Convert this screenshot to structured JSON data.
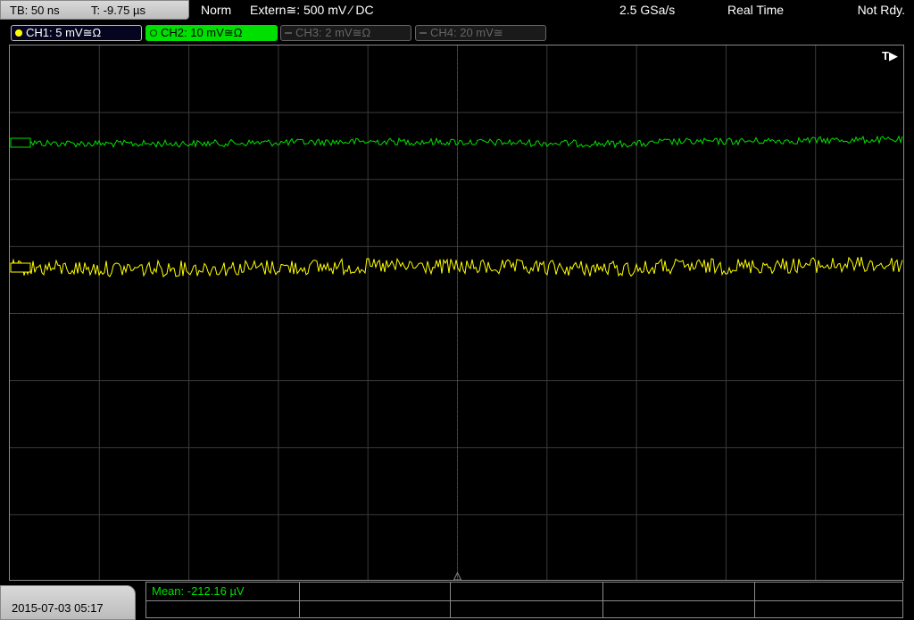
{
  "topbar": {
    "timebase": "TB: 50 ns",
    "trigger_time": "T: -9.75 µs",
    "trigger_mode": "Norm",
    "trigger_source": "Extern≅: 500 mV ⁄ DC",
    "sample_rate": "2.5 GSa/s",
    "acquisition_mode": "Real Time",
    "run_state": "Not Rdy."
  },
  "channels": [
    {
      "label": "CH1: 5 mV≅Ω",
      "color": "#ffff00",
      "state": "on"
    },
    {
      "label": "CH2: 10 mV≅Ω",
      "color": "#00e000",
      "state": "selected"
    },
    {
      "label": "CH3: 2 mV≅Ω",
      "color": "#555555",
      "state": "off"
    },
    {
      "label": "CH4: 20 mV≅",
      "color": "#555555",
      "state": "off"
    }
  ],
  "display": {
    "trigger_marker": "T▶",
    "grid_divisions": {
      "horizontal": 10,
      "vertical": 8
    },
    "traces": [
      {
        "channel": "CH2",
        "color": "#00e000",
        "noise_level": "low"
      },
      {
        "channel": "CH1",
        "color": "#ffff00",
        "noise_level": "high"
      }
    ]
  },
  "footer": {
    "datetime": "2015-07-03 05:17",
    "measurement": "Mean: -212.16 µV"
  }
}
